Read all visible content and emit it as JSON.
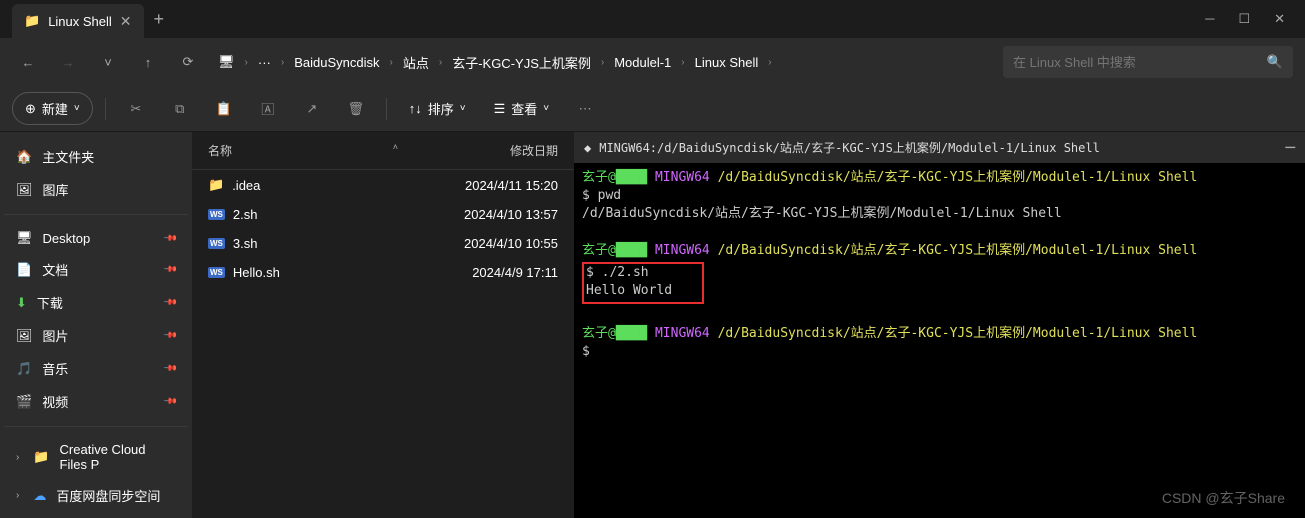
{
  "titlebar": {
    "tab_title": "Linux Shell",
    "add_tab": "+"
  },
  "nav": {
    "breadcrumb": [
      "BaiduSyncdisk",
      "站点",
      "玄子-KGC-YJS上机案例",
      "Modulel-1",
      "Linux Shell"
    ],
    "ellipsis": "···",
    "search_placeholder": "在 Linux Shell 中搜索"
  },
  "actions": {
    "new": "新建",
    "sort": "排序",
    "view": "查看"
  },
  "sidebar": {
    "home": "主文件夹",
    "gallery": "图库",
    "desktop": "Desktop",
    "documents": "文档",
    "downloads": "下载",
    "pictures": "图片",
    "music": "音乐",
    "videos": "视频",
    "creative": "Creative Cloud Files P",
    "baidu": "百度网盘同步空间"
  },
  "files": {
    "columns": {
      "name": "名称",
      "date": "修改日期"
    },
    "rows": [
      {
        "name": ".idea",
        "type": "folder",
        "date": "2024/4/11 15:20"
      },
      {
        "name": "2.sh",
        "type": "ws",
        "date": "2024/4/10 13:57"
      },
      {
        "name": "3.sh",
        "type": "ws",
        "date": "2024/4/10 10:55"
      },
      {
        "name": "Hello.sh",
        "type": "ws",
        "date": "2024/4/9 17:11"
      }
    ]
  },
  "terminal": {
    "title": "MINGW64:/d/BaiduSyncdisk/站点/玄子-KGC-YJS上机案例/Modulel-1/Linux Shell",
    "user": "玄子@",
    "host": "MINGW64",
    "path": "/d/BaiduSyncdisk/站点/玄子-KGC-YJS上机案例/Modulel-1/Linux Shell",
    "cmd1": "$ pwd",
    "out1": "/d/BaiduSyncdisk/站点/玄子-KGC-YJS上机案例/Modulel-1/Linux Shell",
    "cmd2": "$ ./2.sh",
    "out2": "Hello World",
    "cmd3": "$"
  },
  "watermark": "CSDN @玄子Share"
}
